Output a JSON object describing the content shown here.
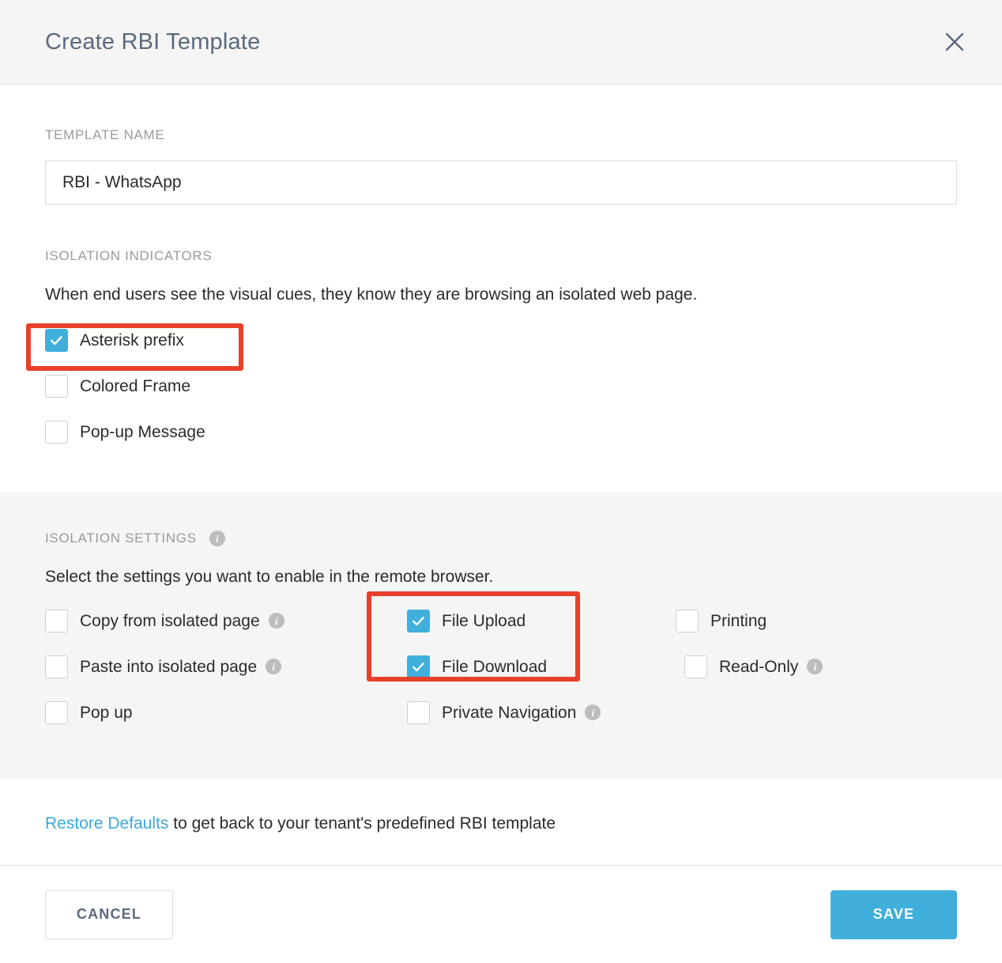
{
  "header": {
    "title": "Create RBI Template",
    "close_icon": "close-icon"
  },
  "template_name": {
    "label": "TEMPLATE NAME",
    "value": "RBI - WhatsApp",
    "placeholder": "Template name"
  },
  "isolation_indicators": {
    "label": "ISOLATION INDICATORS",
    "description": "When end users see the visual cues, they know they are browsing an isolated web page.",
    "options": [
      {
        "label": "Asterisk prefix",
        "checked": true,
        "info": false
      },
      {
        "label": "Colored Frame",
        "checked": false,
        "info": false
      },
      {
        "label": "Pop-up Message",
        "checked": false,
        "info": false
      }
    ]
  },
  "isolation_settings": {
    "label": "ISOLATION SETTINGS",
    "info_icon": "info-icon",
    "description": "Select the settings you want to enable in the remote browser.",
    "options": [
      {
        "label": "Copy from isolated page",
        "checked": false,
        "info": true
      },
      {
        "label": "File Upload",
        "checked": true,
        "info": false
      },
      {
        "label": "Printing",
        "checked": false,
        "info": false
      },
      {
        "label": "Paste into isolated page",
        "checked": false,
        "info": true
      },
      {
        "label": "File Download",
        "checked": true,
        "info": false
      },
      {
        "label": "Read-Only",
        "checked": false,
        "info": true
      },
      {
        "label": "Pop up",
        "checked": false,
        "info": false
      },
      {
        "label": "Private Navigation",
        "checked": false,
        "info": true
      },
      {
        "label": "",
        "checked": false,
        "info": false
      }
    ]
  },
  "restore": {
    "link_label": "Restore Defaults",
    "suffix": " to get back to your tenant's predefined RBI template"
  },
  "footer": {
    "cancel_label": "CANCEL",
    "save_label": "SAVE"
  },
  "colors": {
    "accent": "#41afdb",
    "link": "#3ba9dd",
    "title": "#5b6a7d",
    "panel_gray": "#f5f5f5",
    "annotation_red": "#e8402a"
  },
  "annotations": [
    {
      "name": "highlight-asterisk-prefix"
    },
    {
      "name": "highlight-file-transfer"
    }
  ]
}
